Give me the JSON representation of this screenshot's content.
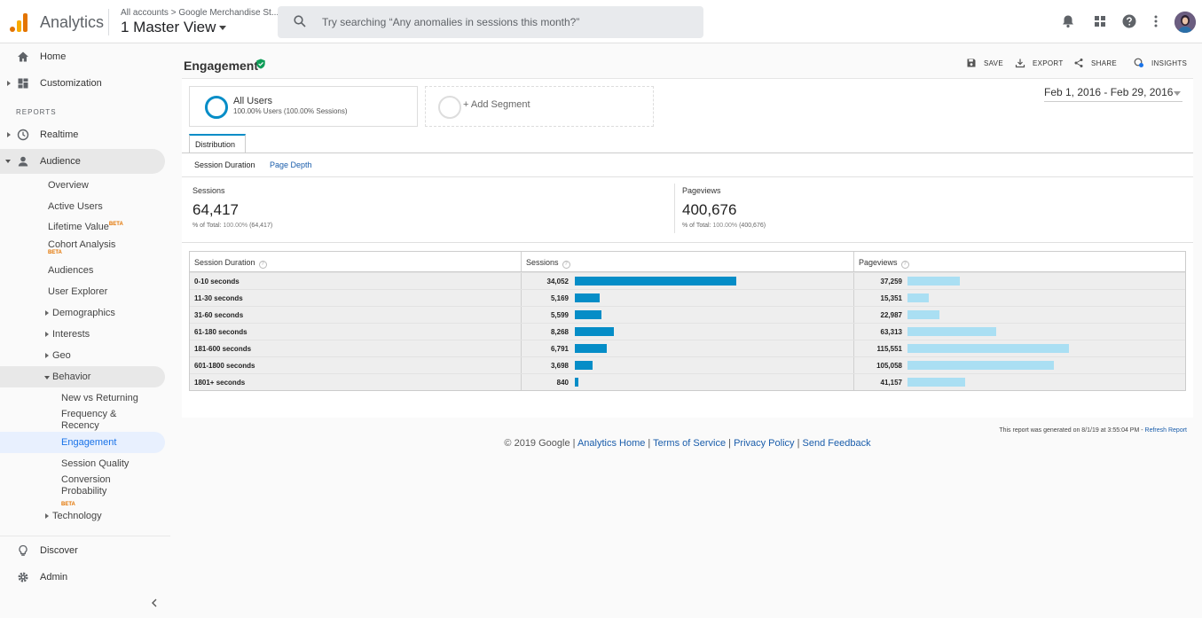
{
  "header": {
    "app_name": "Analytics",
    "breadcrumb": "All accounts > Google Merchandise St...",
    "view_name": "1 Master View",
    "search_placeholder": "Try searching “Any anomalies in sessions this month?”"
  },
  "sidebar": {
    "top_items": [
      {
        "label": "Home",
        "icon": "home-icon"
      },
      {
        "label": "Customization",
        "icon": "dashboard-icon"
      }
    ],
    "reports_label": "REPORTS",
    "realtime": "Realtime",
    "audience": "Audience",
    "audience_items": {
      "overview": "Overview",
      "active_users": "Active Users",
      "lifetime_value": "Lifetime Value",
      "cohort_analysis": "Cohort Analysis",
      "audiences": "Audiences",
      "user_explorer": "User Explorer",
      "demographics": "Demographics",
      "interests": "Interests",
      "geo": "Geo",
      "behavior": "Behavior"
    },
    "behavior_items": {
      "new_vs_returning": "New vs Returning",
      "frequency_recency": "Frequency & Recency",
      "engagement": "Engagement",
      "session_quality": "Session Quality",
      "conversion_probability": "Conversion Probability"
    },
    "technology": "Technology",
    "beta": "BETA",
    "discover": "Discover",
    "admin": "Admin"
  },
  "report": {
    "title": "Engagement",
    "actions": {
      "save": "SAVE",
      "export": "EXPORT",
      "share": "SHARE",
      "insights": "INSIGHTS"
    },
    "segment": {
      "name": "All Users",
      "sub": "100.00% Users (100.00% Sessions)",
      "add": "+ Add Segment"
    },
    "date_range": "Feb 1, 2016 - Feb 29, 2016",
    "tab": "Distribution",
    "subtabs": {
      "active": "Session Duration",
      "link": "Page Depth"
    },
    "metrics": [
      {
        "label": "Sessions",
        "value": "64,417",
        "total_prefix": "% of Total: ",
        "total_pct": "100.00%",
        "total_abs": " (64,417)"
      },
      {
        "label": "Pageviews",
        "value": "400,676",
        "total_prefix": "% of Total: ",
        "total_pct": "100.00%",
        "total_abs": " (400,676)"
      }
    ],
    "table": {
      "headers": [
        "Session Duration",
        "Sessions",
        "Pageviews"
      ],
      "rows": [
        {
          "label": "0-10 seconds",
          "sessions": "34,052",
          "pageviews": "37,259",
          "s": 34052,
          "p": 37259
        },
        {
          "label": "11-30 seconds",
          "sessions": "5,169",
          "pageviews": "15,351",
          "s": 5169,
          "p": 15351
        },
        {
          "label": "31-60 seconds",
          "sessions": "5,599",
          "pageviews": "22,987",
          "s": 5599,
          "p": 22987
        },
        {
          "label": "61-180 seconds",
          "sessions": "8,268",
          "pageviews": "63,313",
          "s": 8268,
          "p": 63313
        },
        {
          "label": "181-600 seconds",
          "sessions": "6,791",
          "pageviews": "115,551",
          "s": 6791,
          "p": 115551
        },
        {
          "label": "601-1800 seconds",
          "sessions": "3,698",
          "pageviews": "105,058",
          "s": 3698,
          "p": 105058
        },
        {
          "label": "1801+ seconds",
          "sessions": "840",
          "pageviews": "41,157",
          "s": 840,
          "p": 41157
        }
      ]
    },
    "generated_note": "This report was generated on 8/1/19 at 3:55:04 PM - ",
    "refresh_label": "Refresh Report"
  },
  "footer": {
    "copyright": "© 2019 Google | ",
    "analytics_home": "Analytics Home",
    "terms": "Terms of Service",
    "privacy": "Privacy Policy",
    "feedback": "Send Feedback",
    "separator": " | "
  },
  "colors": {
    "sessions_bar": "#058dc7",
    "pageviews_bar": "#aadff3",
    "brand_orange": "#e37400"
  }
}
